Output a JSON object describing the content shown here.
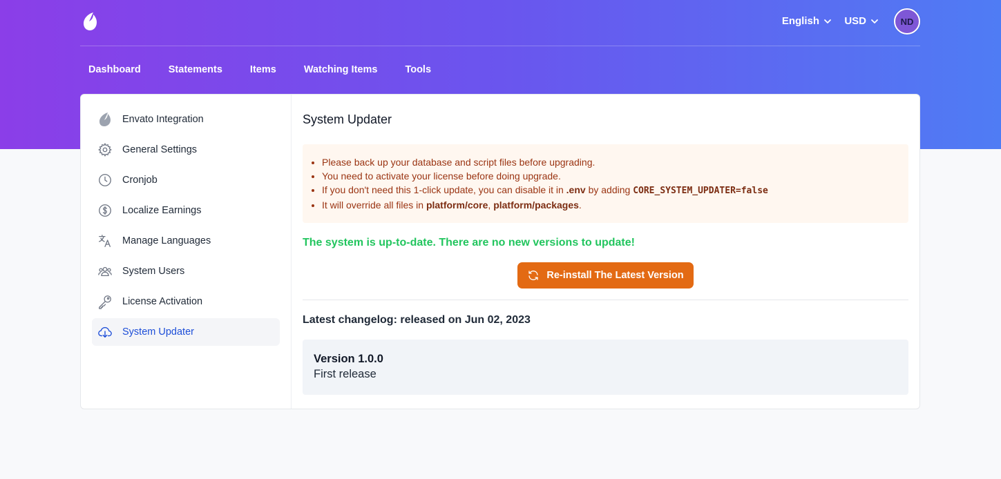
{
  "header": {
    "language": "English",
    "currency": "USD",
    "avatar_initials": "ND"
  },
  "nav": {
    "items": [
      {
        "label": "Dashboard"
      },
      {
        "label": "Statements"
      },
      {
        "label": "Items"
      },
      {
        "label": "Watching Items"
      },
      {
        "label": "Tools"
      }
    ]
  },
  "sidebar": {
    "items": [
      {
        "label": "Envato Integration",
        "icon": "envato-icon"
      },
      {
        "label": "General Settings",
        "icon": "gear-icon"
      },
      {
        "label": "Cronjob",
        "icon": "clock-icon"
      },
      {
        "label": "Localize Earnings",
        "icon": "dollar-icon"
      },
      {
        "label": "Manage Languages",
        "icon": "translate-icon"
      },
      {
        "label": "System Users",
        "icon": "users-icon"
      },
      {
        "label": "License Activation",
        "icon": "key-icon"
      },
      {
        "label": "System Updater",
        "icon": "cloud-download-icon",
        "active": true
      }
    ]
  },
  "main": {
    "title": "System Updater",
    "notice": {
      "line1": "Please back up your database and script files before upgrading.",
      "line2": "You need to activate your license before doing upgrade.",
      "line3_prefix": "If you don't need this 1-click update, you can disable it in ",
      "line3_env": ".env",
      "line3_mid": " by adding ",
      "line3_code": "CORE_SYSTEM_UPDATER=false",
      "line4_prefix": "It will override all files in ",
      "line4_path1": "platform/core",
      "line4_sep": ", ",
      "line4_path2": "platform/packages",
      "line4_end": "."
    },
    "status": "The system is up-to-date. There are no new versions to update!",
    "reinstall_button": "Re-install The Latest Version",
    "changelog_title": "Latest changelog: released on Jun 02, 2023",
    "changelog": {
      "version": "Version 1.0.0",
      "notes": "First release"
    }
  },
  "colors": {
    "accent": "#e36a13",
    "success": "#22c55e",
    "active_link": "#1d4ed8"
  }
}
